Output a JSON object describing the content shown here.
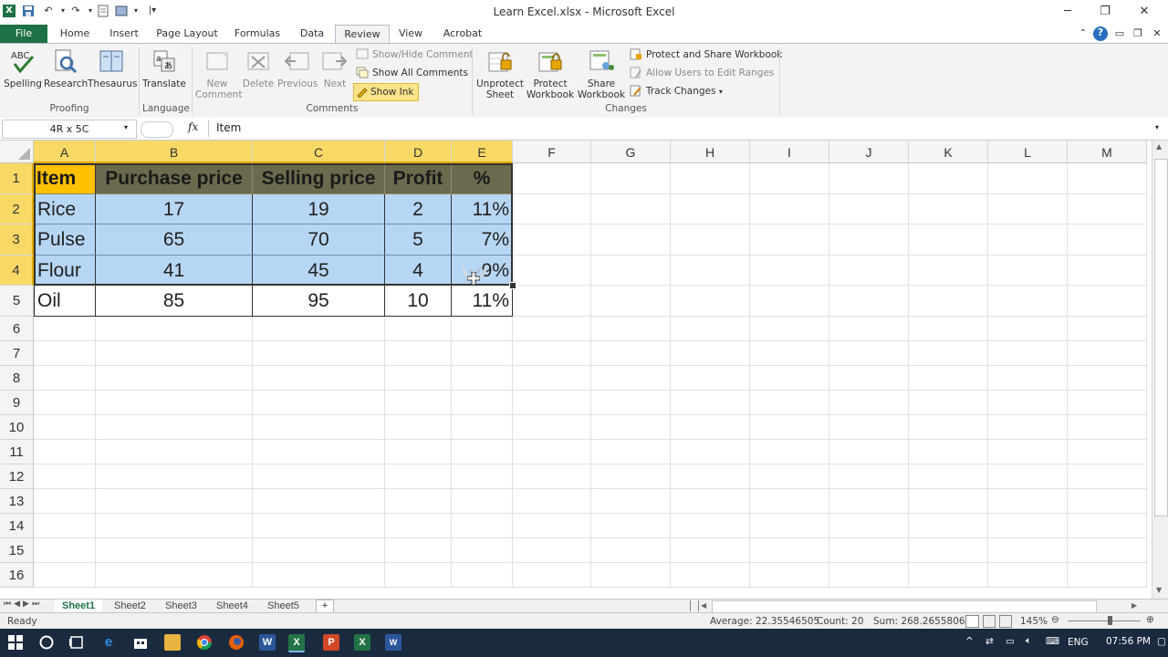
{
  "window": {
    "title": "Learn Excel.xlsx - Microsoft Excel",
    "controls": [
      "─",
      "❐",
      "✕"
    ]
  },
  "ribbon_tabs": [
    {
      "label": "File"
    },
    {
      "label": "Home"
    },
    {
      "label": "Insert"
    },
    {
      "label": "Page Layout"
    },
    {
      "label": "Formulas"
    },
    {
      "label": "Data"
    },
    {
      "label": "Review"
    },
    {
      "label": "View"
    },
    {
      "label": "Acrobat"
    }
  ],
  "active_tab": "Review",
  "ribbon": {
    "proofing": {
      "spelling": "Spelling",
      "research": "Research",
      "thesaurus": "Thesaurus",
      "group": "Proofing"
    },
    "language": {
      "translate": "Translate",
      "group": "Language"
    },
    "comments": {
      "new_comment": "New Comment",
      "delete": "Delete",
      "previous": "Previous",
      "next": "Next",
      "show_hide": "Show/Hide Comment",
      "show_all": "Show All Comments",
      "show_ink": "Show Ink",
      "group": "Comments"
    },
    "changes": {
      "unprotect_sheet": "Unprotect Sheet",
      "protect_workbook": "Protect Workbook",
      "share_workbook": "Share Workbook",
      "protect_share": "Protect and Share Workbook",
      "allow_users": "Allow Users to Edit Ranges",
      "track_changes": "Track Changes",
      "group": "Changes"
    }
  },
  "formula_bar": {
    "name_box": "4R x 5C",
    "fx": "fx",
    "content": "Item"
  },
  "columns": [
    "A",
    "B",
    "C",
    "D",
    "E",
    "F",
    "G",
    "H",
    "I",
    "J",
    "K",
    "L",
    "M"
  ],
  "rows": [
    "1",
    "2",
    "3",
    "4",
    "5",
    "6",
    "7",
    "8",
    "9",
    "10",
    "11",
    "12",
    "13",
    "14",
    "15",
    "16"
  ],
  "table": {
    "headers": [
      "Item",
      "Purchase price",
      "Selling price",
      "Profit",
      "%"
    ],
    "rows": [
      [
        "Rice",
        "17",
        "19",
        "2",
        "11%"
      ],
      [
        "Pulse",
        "65",
        "70",
        "5",
        "7%"
      ],
      [
        "Flour",
        "41",
        "45",
        "4",
        "9%"
      ],
      [
        "Oil",
        "85",
        "95",
        "10",
        "11%"
      ]
    ]
  },
  "sheets": [
    "Sheet1",
    "Sheet2",
    "Sheet3",
    "Sheet4",
    "Sheet5"
  ],
  "active_sheet": "Sheet1",
  "status": {
    "mode": "Ready",
    "average": "Average: 22.35546505",
    "count": "Count: 20",
    "sum": "Sum: 268.2655806",
    "zoom": "145%"
  },
  "taskbar": {
    "lang": "ENG",
    "time": "07:56 PM"
  },
  "colors": {
    "excel_green": "#1e7145",
    "header_fill": "#6b6a4d",
    "item_header_fill": "#ffc000",
    "selection_fill": "#b7d6f4",
    "selected_header": "#f9d966"
  }
}
